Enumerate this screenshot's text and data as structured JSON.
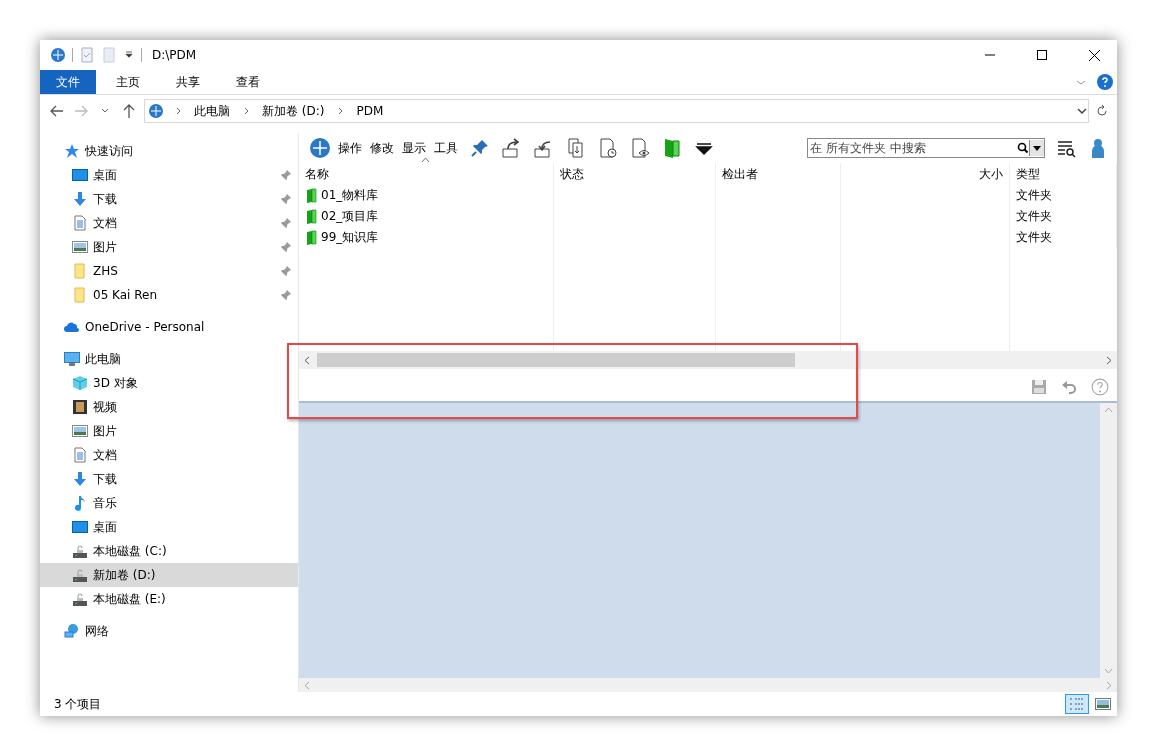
{
  "window": {
    "title": "D:\\PDM"
  },
  "ribbon_tabs": [
    {
      "label": "文件",
      "selected": true
    },
    {
      "label": "主页",
      "selected": false
    },
    {
      "label": "共享",
      "selected": false
    },
    {
      "label": "查看",
      "selected": false
    }
  ],
  "address": {
    "breadcrumbs": [
      "此电脑",
      "新加卷 (D:)",
      "PDM"
    ]
  },
  "sidebar": {
    "items": [
      {
        "label": "快速访问",
        "kind": "star",
        "selected": false,
        "children": [
          {
            "label": "桌面",
            "kind": "desktop",
            "selected": false,
            "pinned": true
          },
          {
            "label": "下载",
            "kind": "download",
            "selected": false,
            "pinned": true
          },
          {
            "label": "文档",
            "kind": "document",
            "selected": false,
            "pinned": true
          },
          {
            "label": "图片",
            "kind": "picture",
            "selected": false,
            "pinned": true
          },
          {
            "label": "ZHS",
            "kind": "folder",
            "selected": false,
            "pinned": true
          },
          {
            "label": "05 Kai Ren",
            "kind": "folder",
            "selected": false,
            "pinned": true
          }
        ]
      },
      {
        "label": "OneDrive - Personal",
        "kind": "cloud",
        "selected": false
      },
      {
        "label": "此电脑",
        "kind": "pc",
        "selected": false,
        "children": [
          {
            "label": "3D 对象",
            "kind": "cube",
            "selected": false,
            "pinned": false
          },
          {
            "label": "视频",
            "kind": "video",
            "selected": false,
            "pinned": false
          },
          {
            "label": "图片",
            "kind": "picture",
            "selected": false,
            "pinned": false
          },
          {
            "label": "文档",
            "kind": "document",
            "selected": false,
            "pinned": false
          },
          {
            "label": "下载",
            "kind": "download",
            "selected": false,
            "pinned": false
          },
          {
            "label": "音乐",
            "kind": "music",
            "selected": false,
            "pinned": false
          },
          {
            "label": "桌面",
            "kind": "desktop",
            "selected": false,
            "pinned": false
          },
          {
            "label": "本地磁盘 (C:)",
            "kind": "drive",
            "selected": false,
            "pinned": false
          },
          {
            "label": "新加卷 (D:)",
            "kind": "drive",
            "selected": true,
            "pinned": false
          },
          {
            "label": "本地磁盘 (E:)",
            "kind": "drive",
            "selected": false,
            "pinned": false
          }
        ]
      },
      {
        "label": "网络",
        "kind": "network",
        "selected": false
      }
    ]
  },
  "pdm_toolbar": {
    "menus": [
      "操作",
      "修改",
      "显示",
      "工具"
    ],
    "search": {
      "placeholder": "在 所有文件夹 中搜索"
    }
  },
  "table": {
    "columns": [
      {
        "label": "名称",
        "sorted": true
      },
      {
        "label": "状态",
        "sorted": false
      },
      {
        "label": "检出者",
        "sorted": false
      },
      {
        "label": "大小",
        "sorted": false
      },
      {
        "label": "类型",
        "sorted": false
      }
    ],
    "rows": [
      {
        "name": "01_物料库",
        "type": "文件夹"
      },
      {
        "name": "02_项目库",
        "type": "文件夹"
      },
      {
        "name": "99_知识库",
        "type": "文件夹"
      }
    ]
  },
  "status_bar": {
    "count": "3 个项目",
    "views": [
      {
        "kind": "details",
        "selected": true
      },
      {
        "kind": "preview",
        "selected": false
      }
    ]
  }
}
